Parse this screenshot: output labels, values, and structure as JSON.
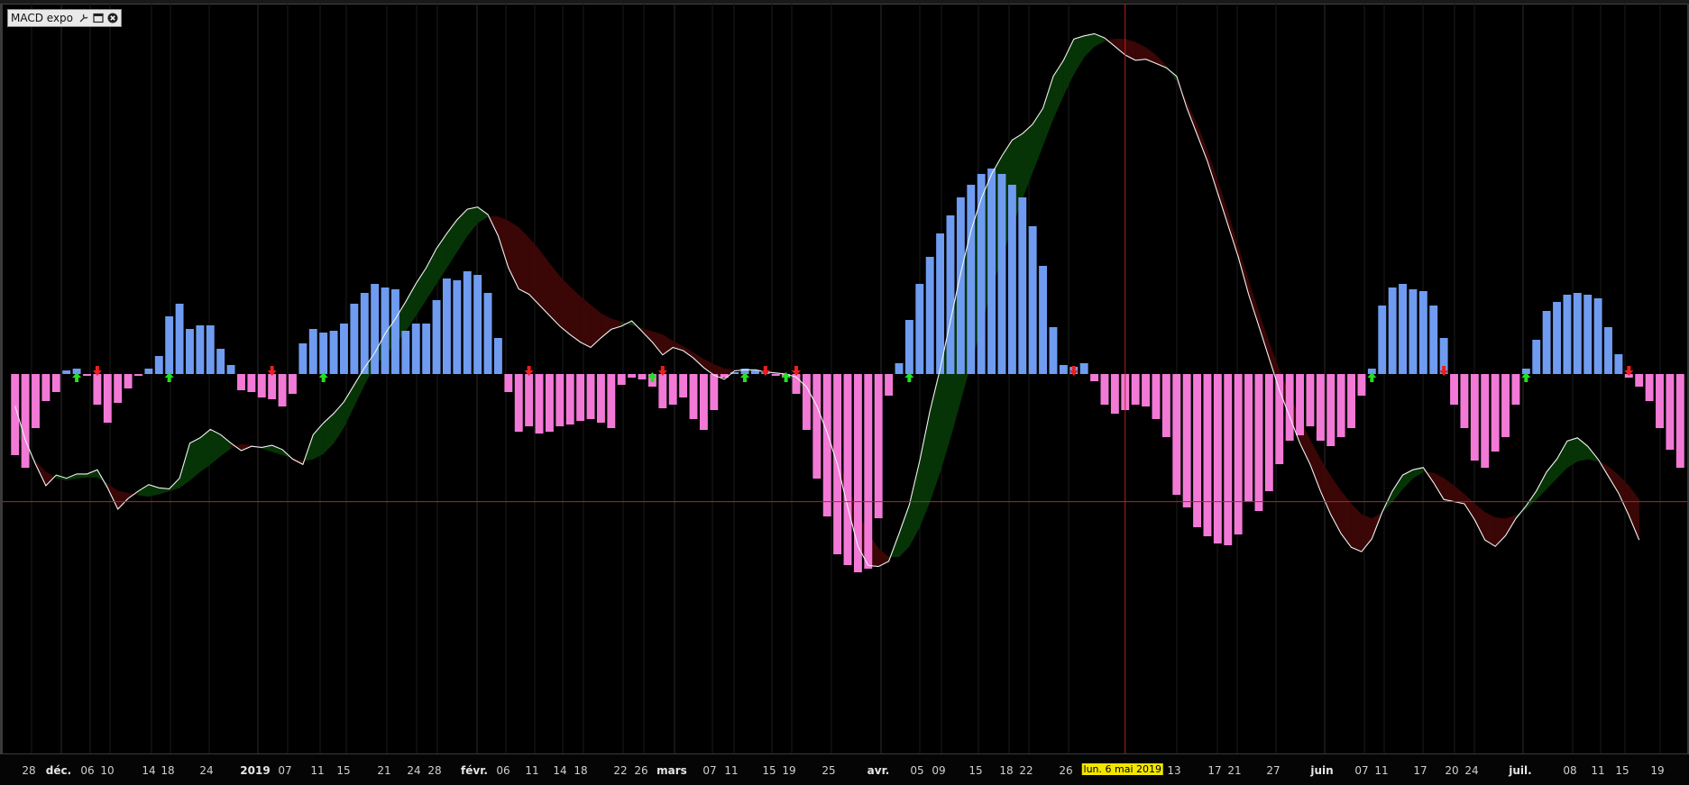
{
  "indicator": {
    "name": "MACD expo",
    "icons": [
      "wrench-icon",
      "window-icon",
      "close-icon"
    ]
  },
  "colors": {
    "background": "#000000",
    "hist_positive": "#6f9cf0",
    "hist_negative": "#f27ad6",
    "fill_bull": "#063406",
    "fill_bear": "#3a0606",
    "line": "#f2f2f2",
    "crosshair": "#c02020",
    "arrow_up": "#22e022",
    "arrow_down": "#e82020",
    "cursor_label_bg": "#f2e600"
  },
  "axis": {
    "ticks": [
      {
        "label": "28",
        "major": false
      },
      {
        "label": "déc.",
        "major": true
      },
      {
        "label": "06",
        "major": false
      },
      {
        "label": "10",
        "major": false
      },
      {
        "label": "14",
        "major": false
      },
      {
        "label": "18",
        "major": false
      },
      {
        "label": "24",
        "major": false
      },
      {
        "label": "2019",
        "major": true
      },
      {
        "label": "07",
        "major": false
      },
      {
        "label": "11",
        "major": false
      },
      {
        "label": "15",
        "major": false
      },
      {
        "label": "21",
        "major": false
      },
      {
        "label": "24",
        "major": false
      },
      {
        "label": "28",
        "major": false
      },
      {
        "label": "févr.",
        "major": true
      },
      {
        "label": "06",
        "major": false
      },
      {
        "label": "11",
        "major": false
      },
      {
        "label": "14",
        "major": false
      },
      {
        "label": "18",
        "major": false
      },
      {
        "label": "22",
        "major": false
      },
      {
        "label": "26",
        "major": false
      },
      {
        "label": "mars",
        "major": true
      },
      {
        "label": "07",
        "major": false
      },
      {
        "label": "11",
        "major": false
      },
      {
        "label": "15",
        "major": false
      },
      {
        "label": "19",
        "major": false
      },
      {
        "label": "25",
        "major": false
      },
      {
        "label": "avr.",
        "major": true
      },
      {
        "label": "05",
        "major": false
      },
      {
        "label": "09",
        "major": false
      },
      {
        "label": "15",
        "major": false
      },
      {
        "label": "18",
        "major": false
      },
      {
        "label": "22",
        "major": false
      },
      {
        "label": "26",
        "major": false
      },
      {
        "label": "13",
        "major": false
      },
      {
        "label": "17",
        "major": false
      },
      {
        "label": "21",
        "major": false
      },
      {
        "label": "27",
        "major": false
      },
      {
        "label": "juin",
        "major": true
      },
      {
        "label": "07",
        "major": false
      },
      {
        "label": "11",
        "major": false
      },
      {
        "label": "17",
        "major": false
      },
      {
        "label": "20",
        "major": false
      },
      {
        "label": "24",
        "major": false
      },
      {
        "label": "juil.",
        "major": true
      },
      {
        "label": "08",
        "major": false
      },
      {
        "label": "11",
        "major": false
      },
      {
        "label": "15",
        "major": false
      },
      {
        "label": "19",
        "major": false
      }
    ],
    "cursor_date": "lun. 6 mai 2019"
  },
  "chart_data": {
    "type": "bar",
    "title": "MACD expo",
    "xlabel": "",
    "ylabel": "",
    "grid": true,
    "histogram": [
      -0.45,
      -0.52,
      -0.3,
      -0.15,
      -0.1,
      0.02,
      0.03,
      -0.01,
      -0.17,
      -0.27,
      -0.16,
      -0.08,
      -0.01,
      0.03,
      0.1,
      0.32,
      0.39,
      0.25,
      0.27,
      0.27,
      0.14,
      0.05,
      -0.09,
      -0.1,
      -0.13,
      -0.14,
      -0.18,
      -0.11,
      0.17,
      0.25,
      0.23,
      0.24,
      0.28,
      0.39,
      0.45,
      0.5,
      0.48,
      0.47,
      0.24,
      0.28,
      0.28,
      0.41,
      0.53,
      0.52,
      0.57,
      0.55,
      0.45,
      0.2,
      -0.1,
      -0.32,
      -0.29,
      -0.33,
      -0.32,
      -0.29,
      -0.28,
      -0.26,
      -0.25,
      -0.27,
      -0.3,
      -0.06,
      -0.02,
      -0.03,
      -0.07,
      -0.19,
      -0.17,
      -0.13,
      -0.25,
      -0.31,
      -0.2,
      -0.02,
      0.01,
      0.03,
      0.02,
      0.02,
      -0.01,
      -0.02,
      -0.11,
      -0.31,
      -0.58,
      -0.79,
      -1.0,
      -1.06,
      -1.1,
      -1.08,
      -0.8,
      -0.12,
      0.06,
      0.3,
      0.5,
      0.65,
      0.78,
      0.88,
      0.98,
      1.05,
      1.11,
      1.14,
      1.11,
      1.05,
      0.98,
      0.82,
      0.6,
      0.26,
      0.05,
      0.04,
      0.06,
      -0.04,
      -0.17,
      -0.22,
      -0.2,
      -0.17,
      -0.18,
      -0.25,
      -0.35,
      -0.67,
      -0.74,
      -0.85,
      -0.9,
      -0.94,
      -0.95,
      -0.89,
      -0.71,
      -0.76,
      -0.65,
      -0.5,
      -0.37,
      -0.34,
      -0.29,
      -0.37,
      -0.4,
      -0.35,
      -0.3,
      -0.12,
      0.03,
      0.38,
      0.48,
      0.5,
      0.47,
      0.46,
      0.38,
      0.2,
      -0.17,
      -0.3,
      -0.48,
      -0.52,
      -0.43,
      -0.35,
      -0.17,
      0.03,
      0.19,
      0.35,
      0.4,
      0.44,
      0.45,
      0.44,
      0.42,
      0.26,
      0.11,
      -0.02,
      -0.07,
      -0.15,
      -0.3,
      -0.42,
      -0.52
    ],
    "macd": [
      -0.3,
      -0.62,
      -0.85,
      -1.05,
      -0.95,
      -0.98,
      -0.94,
      -0.94,
      -0.9,
      -1.07,
      -1.27,
      -1.17,
      -1.1,
      -1.04,
      -1.07,
      -1.08,
      -0.98,
      -0.65,
      -0.6,
      -0.52,
      -0.57,
      -0.65,
      -0.72,
      -0.68,
      -0.69,
      -0.67,
      -0.71,
      -0.8,
      -0.85,
      -0.57,
      -0.46,
      -0.37,
      -0.26,
      -0.1,
      0.06,
      0.2,
      0.38,
      0.52,
      0.68,
      0.85,
      1.0,
      1.18,
      1.32,
      1.45,
      1.55,
      1.57,
      1.5,
      1.3,
      1.0,
      0.8,
      0.75,
      0.65,
      0.55,
      0.45,
      0.37,
      0.3,
      0.25,
      0.34,
      0.42,
      0.45,
      0.5,
      0.4,
      0.3,
      0.18,
      0.25,
      0.22,
      0.15,
      0.06,
      -0.01,
      -0.05,
      0.03,
      0.04,
      0.04,
      0.02,
      0.01,
      0.0,
      -0.03,
      -0.12,
      -0.3,
      -0.55,
      -0.85,
      -1.25,
      -1.62,
      -1.8,
      -1.81,
      -1.76,
      -1.5,
      -1.23,
      -0.82,
      -0.35,
      0.05,
      0.5,
      0.95,
      1.35,
      1.65,
      1.88,
      2.05,
      2.2,
      2.26,
      2.35,
      2.5,
      2.8,
      2.95,
      3.15,
      3.18,
      3.2,
      3.16,
      3.08,
      3.0,
      2.95,
      2.96,
      2.92,
      2.88,
      2.8,
      2.5,
      2.25,
      2.0,
      1.7,
      1.4,
      1.1,
      0.75,
      0.45,
      0.15,
      -0.15,
      -0.4,
      -0.65,
      -0.85,
      -1.1,
      -1.32,
      -1.5,
      -1.63,
      -1.67,
      -1.55,
      -1.3,
      -1.1,
      -0.95,
      -0.9,
      -0.88,
      -1.02,
      -1.18,
      -1.2,
      -1.22,
      -1.37,
      -1.56,
      -1.62,
      -1.52,
      -1.36,
      -1.24,
      -1.1,
      -0.92,
      -0.8,
      -0.63,
      -0.6,
      -0.68,
      -0.8,
      -0.96,
      -1.12,
      -1.33,
      -1.56
    ],
    "signal": [
      -0.55,
      -0.7,
      -0.82,
      -0.92,
      -0.98,
      -1.0,
      -0.98,
      -0.97,
      -0.97,
      -1.03,
      -1.1,
      -1.12,
      -1.14,
      -1.15,
      -1.13,
      -1.1,
      -1.07,
      -1.0,
      -0.92,
      -0.85,
      -0.77,
      -0.7,
      -0.66,
      -0.67,
      -0.7,
      -0.73,
      -0.76,
      -0.79,
      -0.82,
      -0.8,
      -0.75,
      -0.65,
      -0.5,
      -0.3,
      -0.1,
      0.08,
      0.18,
      0.28,
      0.4,
      0.55,
      0.7,
      0.85,
      1.0,
      1.15,
      1.3,
      1.42,
      1.48,
      1.48,
      1.44,
      1.38,
      1.28,
      1.17,
      1.04,
      0.92,
      0.82,
      0.73,
      0.65,
      0.57,
      0.52,
      0.49,
      0.46,
      0.43,
      0.4,
      0.37,
      0.31,
      0.26,
      0.2,
      0.14,
      0.09,
      0.05,
      0.04,
      0.03,
      0.02,
      0.01,
      0.0,
      -0.02,
      -0.07,
      -0.16,
      -0.3,
      -0.52,
      -0.78,
      -1.05,
      -1.3,
      -1.5,
      -1.64,
      -1.72,
      -1.72,
      -1.62,
      -1.44,
      -1.2,
      -0.92,
      -0.6,
      -0.25,
      0.1,
      0.45,
      0.8,
      1.1,
      1.38,
      1.65,
      1.9,
      2.15,
      2.4,
      2.62,
      2.82,
      2.98,
      3.08,
      3.13,
      3.15,
      3.15,
      3.12,
      3.07,
      3.0,
      2.9,
      2.75,
      2.56,
      2.35,
      2.1,
      1.82,
      1.52,
      1.2,
      0.88,
      0.58,
      0.3,
      0.04,
      -0.2,
      -0.42,
      -0.62,
      -0.8,
      -0.96,
      -1.1,
      -1.22,
      -1.32,
      -1.36,
      -1.3,
      -1.2,
      -1.08,
      -0.98,
      -0.92,
      -0.93,
      -0.98,
      -1.05,
      -1.13,
      -1.22,
      -1.3,
      -1.35,
      -1.36,
      -1.33,
      -1.27,
      -1.18,
      -1.08,
      -0.98,
      -0.88,
      -0.82,
      -0.8,
      -0.82,
      -0.87,
      -0.95,
      -1.05,
      -1.18
    ],
    "crossovers": [
      {
        "bar": 6,
        "dir": "up"
      },
      {
        "bar": 8,
        "dir": "down"
      },
      {
        "bar": 15,
        "dir": "up"
      },
      {
        "bar": 25,
        "dir": "down"
      },
      {
        "bar": 30,
        "dir": "up"
      },
      {
        "bar": 50,
        "dir": "down"
      },
      {
        "bar": 62,
        "dir": "up"
      },
      {
        "bar": 63,
        "dir": "down"
      },
      {
        "bar": 71,
        "dir": "up"
      },
      {
        "bar": 73,
        "dir": "down"
      },
      {
        "bar": 75,
        "dir": "up"
      },
      {
        "bar": 76,
        "dir": "down"
      },
      {
        "bar": 87,
        "dir": "up"
      },
      {
        "bar": 103,
        "dir": "down"
      },
      {
        "bar": 132,
        "dir": "up"
      },
      {
        "bar": 139,
        "dir": "down"
      },
      {
        "bar": 147,
        "dir": "up"
      },
      {
        "bar": 157,
        "dir": "down"
      }
    ],
    "crosshair": {
      "bar": 108,
      "value": -1.2
    }
  }
}
